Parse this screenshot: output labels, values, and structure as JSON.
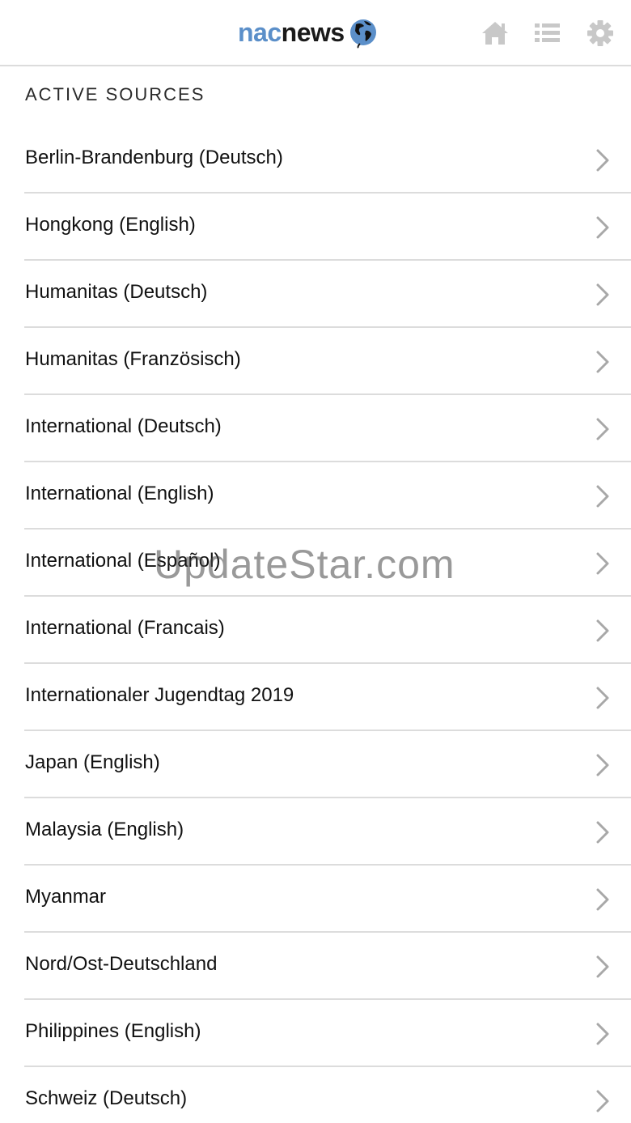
{
  "header": {
    "logo_part1": "nac",
    "logo_part2": "news",
    "icons": [
      "home-icon",
      "list-icon",
      "gear-icon"
    ]
  },
  "section_title": "ACTIVE SOURCES",
  "sources": [
    {
      "label": "Berlin-Brandenburg (Deutsch)"
    },
    {
      "label": "Hongkong (English)"
    },
    {
      "label": "Humanitas (Deutsch)"
    },
    {
      "label": "Humanitas (Französisch)"
    },
    {
      "label": "International (Deutsch)"
    },
    {
      "label": "International (English)"
    },
    {
      "label": "International (Español)"
    },
    {
      "label": "International (Francais)"
    },
    {
      "label": "Internationaler Jugendtag 2019"
    },
    {
      "label": "Japan (English)"
    },
    {
      "label": "Malaysia (English)"
    },
    {
      "label": "Myanmar"
    },
    {
      "label": "Nord/Ost-Deutschland"
    },
    {
      "label": "Philippines (English)"
    },
    {
      "label": "Schweiz (Deutsch)"
    }
  ],
  "watermark": "UpdateStar.com",
  "colors": {
    "logo_accent": "#5b8fc9",
    "icon_gray": "#c8c8c8",
    "divider": "#dcdcdc"
  }
}
